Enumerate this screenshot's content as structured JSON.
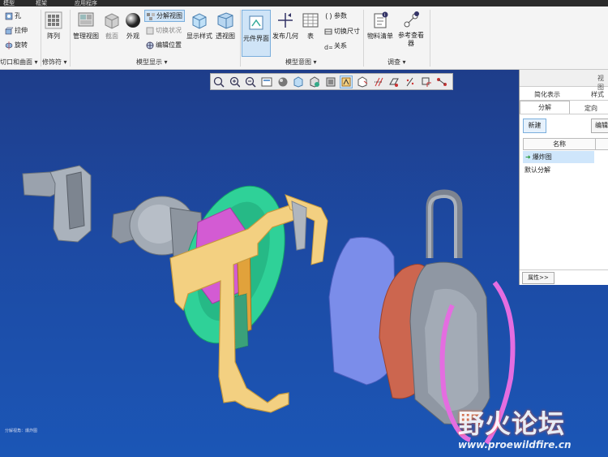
{
  "menubar": {
    "items": [
      "模型",
      "框架",
      "应用程序"
    ]
  },
  "ribbon": {
    "col1_items": [
      "孔",
      "拉伸",
      "旋转"
    ],
    "group1_label": "切口和曲面 ▾",
    "pattern_label": "阵列",
    "group2_label": "修饰符 ▾",
    "manage_view": "管理视图",
    "section": "截面",
    "appearance": "外观",
    "explode_view": "分解视图",
    "toggle_state": "切换状况",
    "edit_position": "编辑位置",
    "display_style": "显示样式",
    "perspective": "透视图",
    "group3_label": "模型显示 ▾",
    "component_interface": "元件界面",
    "publish_geometry": "发布几何",
    "table": "表",
    "params": "参数",
    "switch_dims": "切换尺寸",
    "relations": "关系",
    "group4_label": "模型意图 ▾",
    "bom": "物料清单",
    "ref_viewer": "参考查看器",
    "group5_label": "调查 ▾"
  },
  "panel": {
    "header": "视图",
    "tab_simplified": "简化表示",
    "tab_style": "样式",
    "tab_explode": "分解",
    "tab_orient": "定向",
    "new_button": "新建",
    "edit_button": "编辑",
    "col_name": "名称",
    "item_selected": "爆炸图",
    "item_default": "默认分解",
    "properties_button": "属性>>"
  },
  "viewport": {
    "footer_text": "分解视角：爆炸图"
  },
  "watermark": {
    "text_cn": "野火论坛",
    "url": "www.proewildfire.cn"
  }
}
